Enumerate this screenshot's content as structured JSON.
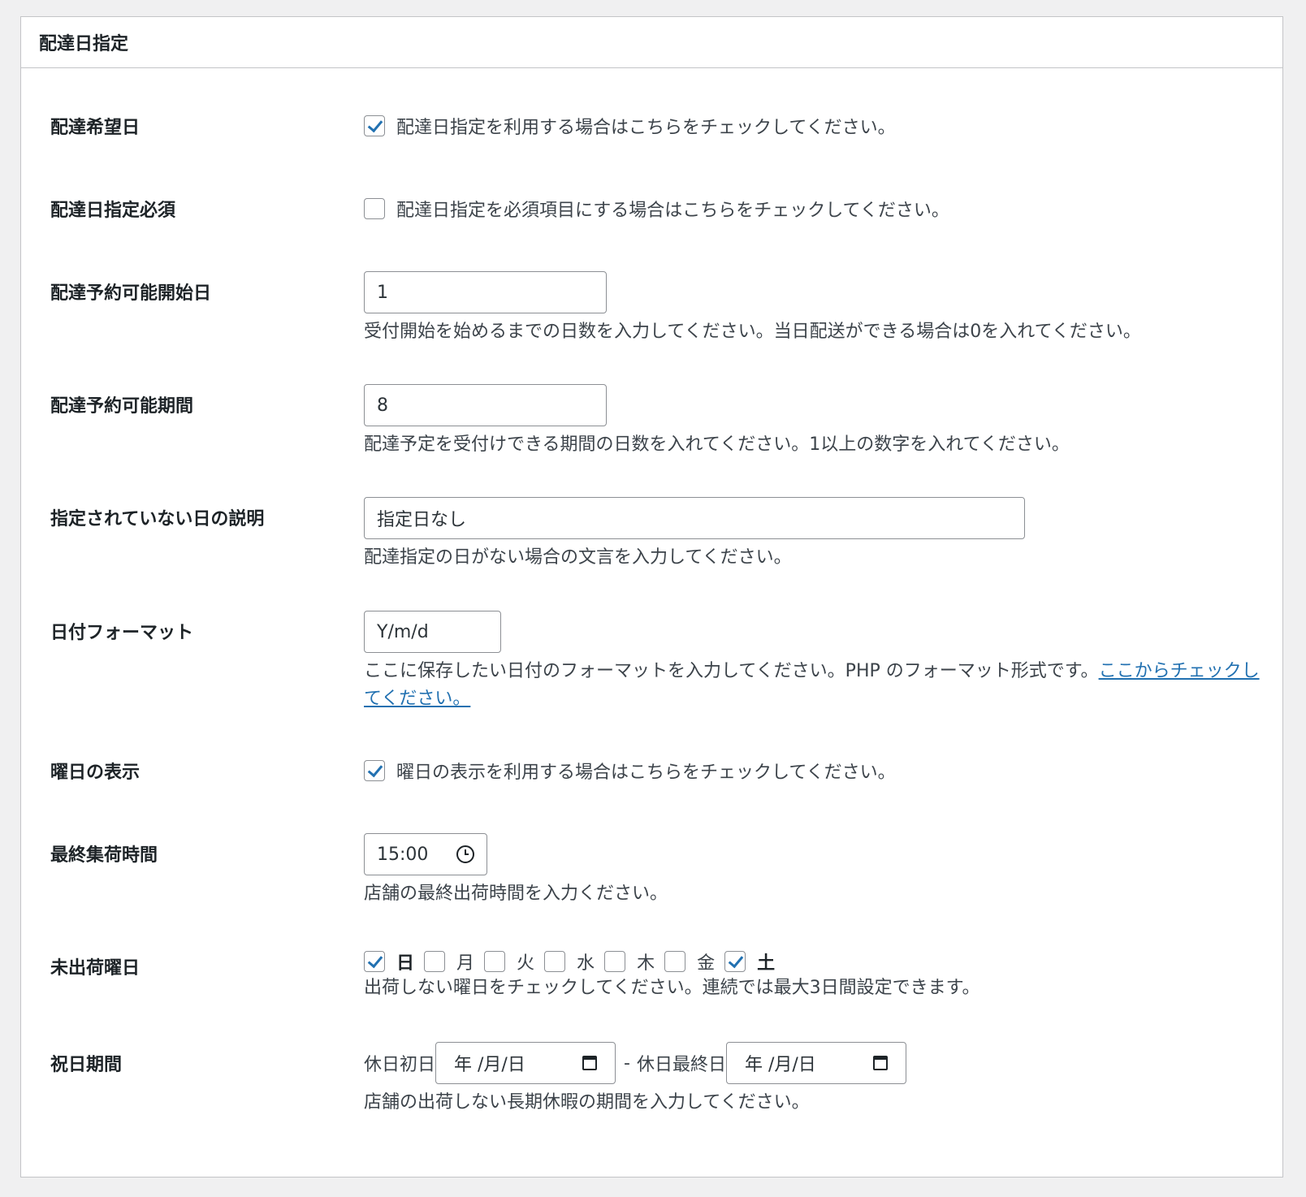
{
  "panel": {
    "title": "配達日指定"
  },
  "rows": {
    "delivery_request": {
      "label": "配達希望日",
      "checked": true,
      "text": "配達日指定を利用する場合はこちらをチェックしてください。"
    },
    "required": {
      "label": "配達日指定必須",
      "checked": false,
      "text": "配達日指定を必須項目にする場合はこちらをチェックしてください。"
    },
    "start_day": {
      "label": "配達予約可能開始日",
      "value": "1",
      "desc": "受付開始を始めるまでの日数を入力してください。当日配送ができる場合は0を入れてください。"
    },
    "period": {
      "label": "配達予約可能期間",
      "value": "8",
      "desc": "配達予定を受付けできる期間の日数を入れてください。1以上の数字を入れてください。"
    },
    "unspecified": {
      "label": "指定されていない日の説明",
      "value": "指定日なし",
      "desc": "配達指定の日がない場合の文言を入力してください。"
    },
    "date_format": {
      "label": "日付フォーマット",
      "value": "Y/m/d",
      "desc": "ここに保存したい日付のフォーマットを入力してください。PHP のフォーマット形式です。",
      "link": "ここからチェックしてください。"
    },
    "weekday": {
      "label": "曜日の表示",
      "checked": true,
      "text": "曜日の表示を利用する場合はこちらをチェックしてください。"
    },
    "last_ship": {
      "label": "最終集荷時間",
      "value": "15:00",
      "desc": "店舗の最終出荷時間を入力ください。"
    },
    "no_ship_days": {
      "label": "未出荷曜日",
      "days": [
        {
          "label": "日",
          "checked": true
        },
        {
          "label": "月",
          "checked": false
        },
        {
          "label": "火",
          "checked": false
        },
        {
          "label": "水",
          "checked": false
        },
        {
          "label": "木",
          "checked": false
        },
        {
          "label": "金",
          "checked": false
        },
        {
          "label": "土",
          "checked": true
        }
      ],
      "desc": "出荷しない曜日をチェックしてください。連続では最大3日間設定できます。"
    },
    "holiday": {
      "label": "祝日期間",
      "start_label": "休日初日",
      "separator": "-",
      "end_label": "休日最終日",
      "start_placeholder": "年 /月/日",
      "end_placeholder": "年 /月/日",
      "desc": "店舗の出荷しない長期休暇の期間を入力してください。"
    }
  }
}
